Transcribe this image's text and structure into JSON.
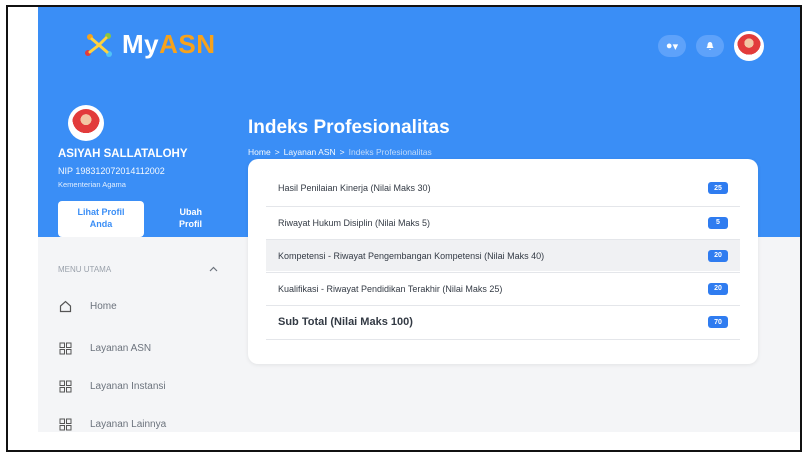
{
  "app": {
    "brand_prefix": "My",
    "brand_accent": "ASN"
  },
  "header": {
    "help_caret": "▾"
  },
  "profile": {
    "name": "ASIYAH SALLATALOHY",
    "nip": "NIP 198312072014112002",
    "agency": "Kementerian Agama",
    "view_profile_line1": "Lihat Profil",
    "view_profile_line2": "Anda",
    "edit_profile_line1": "Ubah",
    "edit_profile_line2": "Profil"
  },
  "page": {
    "title": "Indeks Profesionalitas",
    "breadcrumb": [
      "Home",
      "Layanan ASN",
      "Indeks Profesionalitas"
    ],
    "breadcrumb_sep": ">"
  },
  "sidebar": {
    "section_label": "MENU UTAMA",
    "items": [
      {
        "label": "Home",
        "icon": "home-icon"
      },
      {
        "label": "Layanan ASN",
        "icon": "grid-icon"
      },
      {
        "label": "Layanan Instansi",
        "icon": "grid-icon"
      },
      {
        "label": "Layanan Lainnya",
        "icon": "grid-icon"
      }
    ]
  },
  "scores": {
    "rows": [
      {
        "label": "Hasil Penilaian Kinerja (Nilai Maks 30)",
        "value": "25"
      },
      {
        "label": "Riwayat Hukum Disiplin (Nilai Maks 5)",
        "value": "5"
      },
      {
        "label": "Kompetensi - Riwayat Pengembangan Kompetensi (Nilai Maks 40)",
        "value": "20"
      },
      {
        "label": "Kualifikasi - Riwayat Pendidikan Terakhir (Nilai Maks 25)",
        "value": "20"
      }
    ],
    "total": {
      "label": "Sub Total (Nilai Maks 100)",
      "value": "70"
    }
  },
  "colors": {
    "primary": "#3a8ef6",
    "badge": "#2f7cf0",
    "accent": "#f7a21b"
  }
}
